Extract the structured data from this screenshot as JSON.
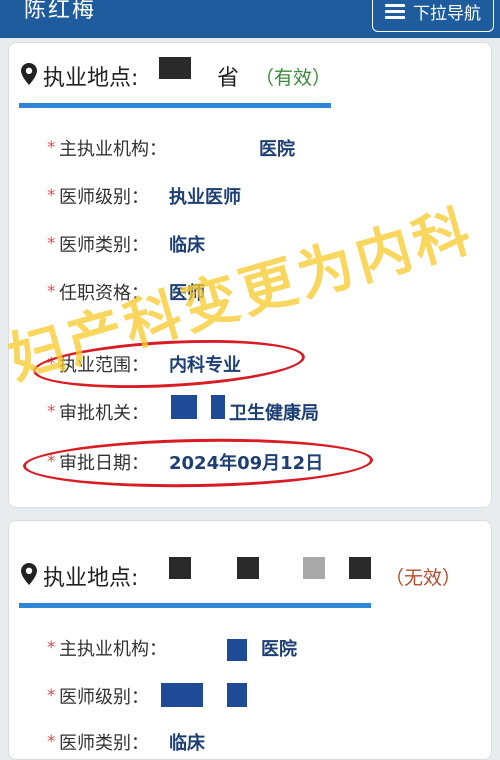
{
  "header": {
    "title": "陈红梅",
    "nav_button_label": "下拉导航"
  },
  "practice_1": {
    "location_label": "执业地点:",
    "location_suffix": "省",
    "status": "（有效）",
    "fields": [
      {
        "label": "主执业机构：",
        "value": "医院"
      },
      {
        "label": "医师级别：",
        "value": "执业医师"
      },
      {
        "label": "医师类别：",
        "value": "临床"
      },
      {
        "label": "任职资格：",
        "value": "医师"
      },
      {
        "label": "执业范围：",
        "value": "内科专业"
      },
      {
        "label": "审批机关：",
        "value": "卫生健康局"
      },
      {
        "label": "审批日期：",
        "value": "2024年09月12日"
      }
    ]
  },
  "practice_2": {
    "location_label": "执业地点:",
    "status": "（无效）",
    "fields": [
      {
        "label": "主执业机构：",
        "value": "医院"
      },
      {
        "label": "医师级别：",
        "value": ""
      },
      {
        "label": "医师类别：",
        "value": "临床"
      }
    ]
  },
  "annotation": {
    "text": "妇产科变更为内科",
    "color": "#f7cc32",
    "circle_color": "#d91c24"
  },
  "colors": {
    "header_bg": "#1f5c9e",
    "accent": "#2f86d6",
    "value_text": "#1e3f73",
    "required_star": "#d9534f"
  }
}
